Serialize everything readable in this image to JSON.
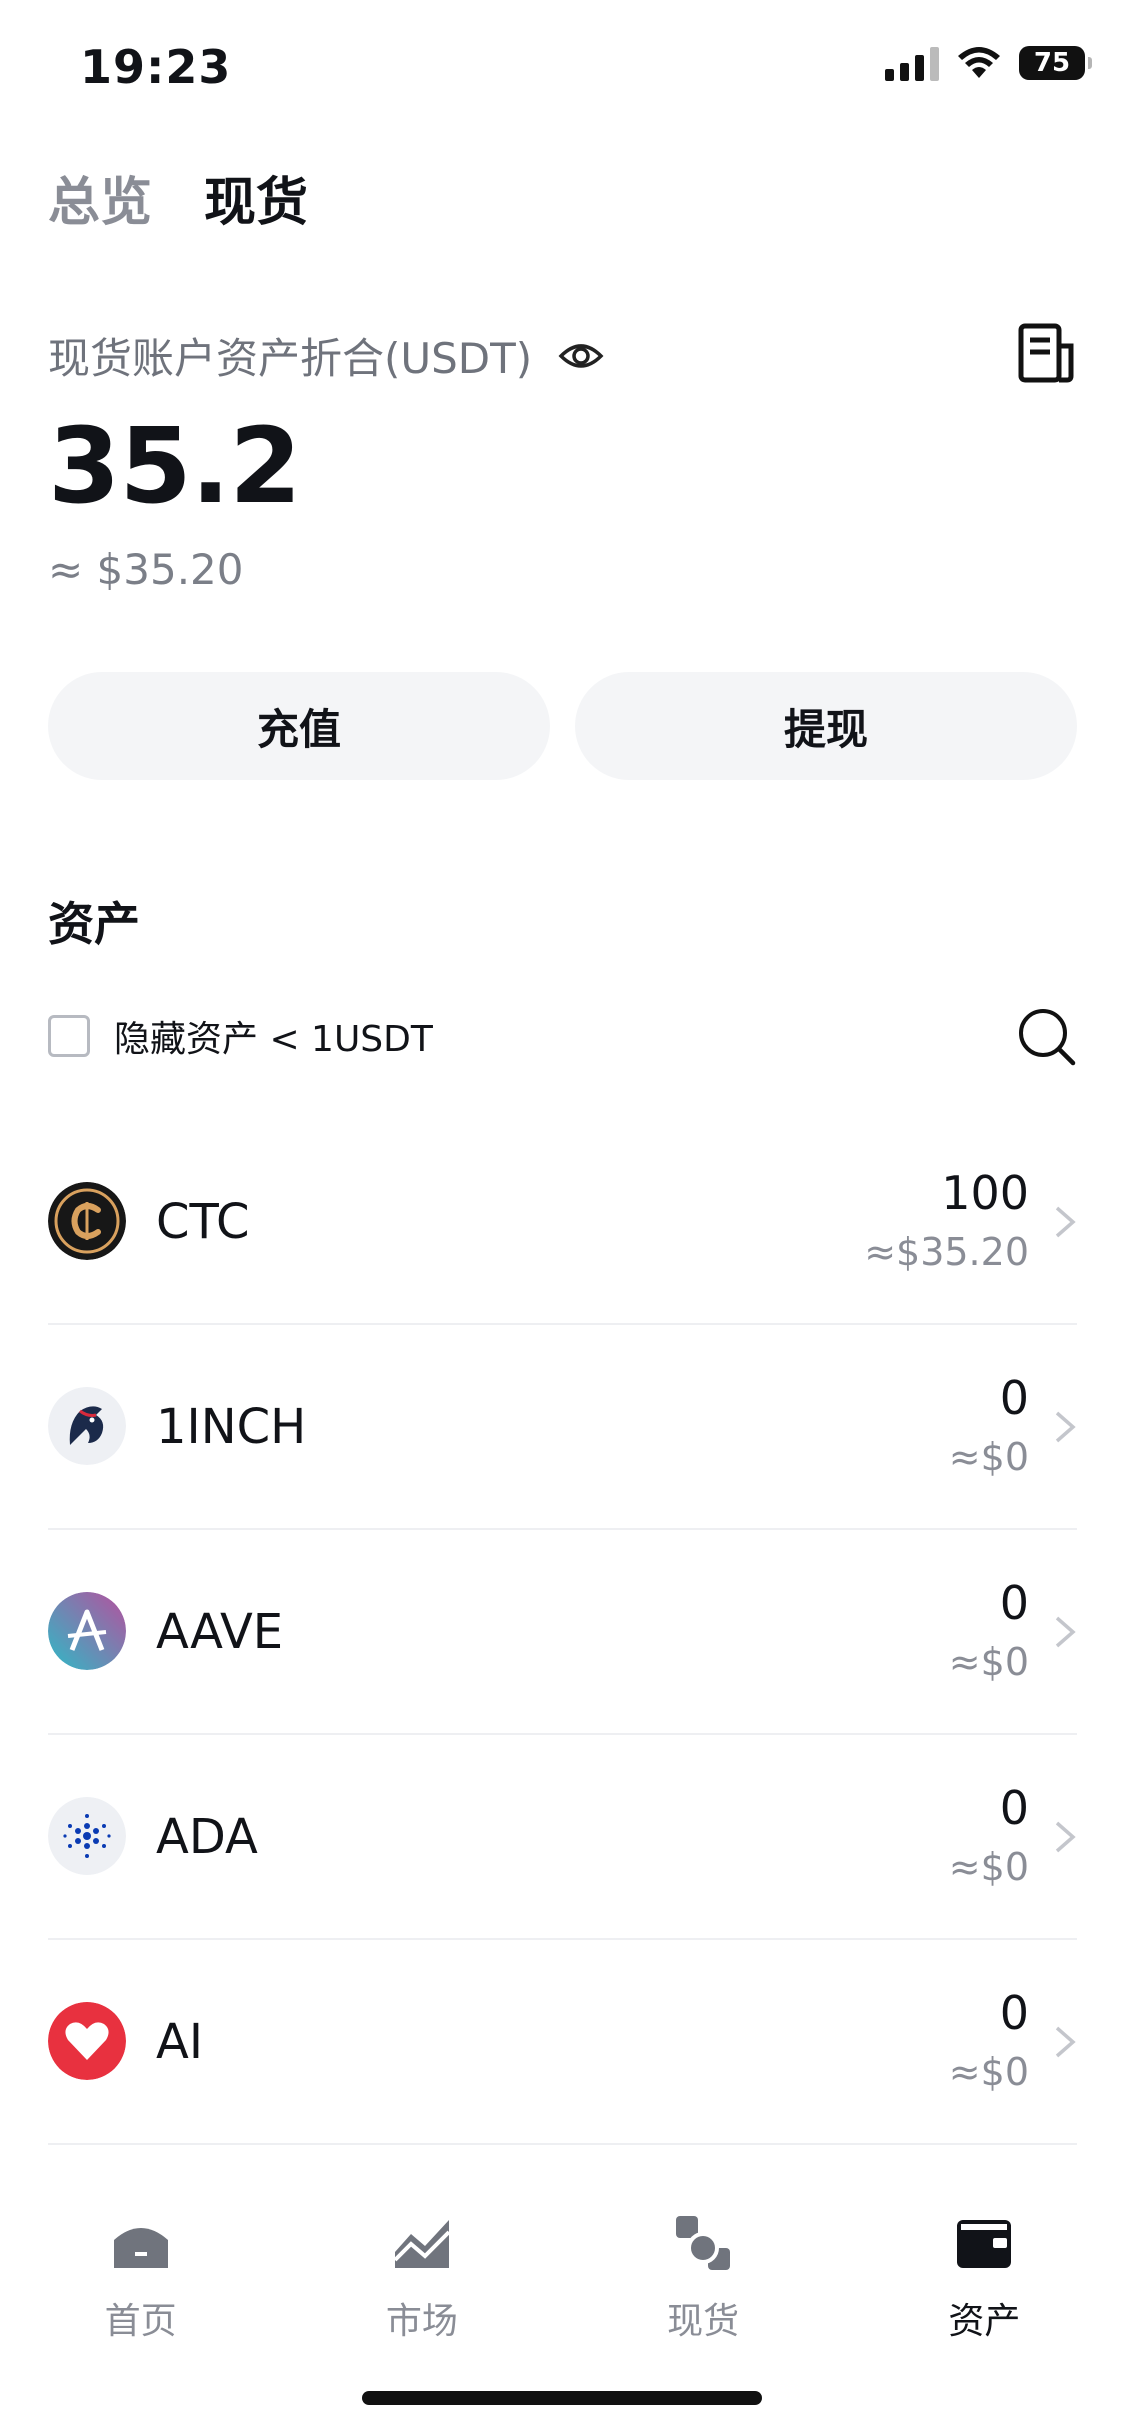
{
  "status_bar": {
    "time": "19:23",
    "battery": "75"
  },
  "top_tabs": [
    {
      "label": "总览",
      "active": false
    },
    {
      "label": "现货",
      "active": true
    }
  ],
  "account": {
    "label": "现货账户资产折合(USDT)",
    "balance": "35.2",
    "balance_usd": "≈ $35.20"
  },
  "actions": {
    "deposit_label": "充值",
    "withdraw_label": "提现"
  },
  "assets_section": {
    "title": "资产",
    "hide_small_label": "隐藏资产 < 1USDT",
    "hide_small_checked": false
  },
  "assets": [
    {
      "name": "CTC",
      "amount": "100",
      "value": "≈$35.20",
      "icon": "ctc-coin"
    },
    {
      "name": "1INCH",
      "amount": "0",
      "value": "≈$0",
      "icon": "1inch-coin"
    },
    {
      "name": "AAVE",
      "amount": "0",
      "value": "≈$0",
      "icon": "aave-coin"
    },
    {
      "name": "ADA",
      "amount": "0",
      "value": "≈$0",
      "icon": "ada-coin"
    },
    {
      "name": "AI",
      "amount": "0",
      "value": "≈$0",
      "icon": "ai-coin"
    }
  ],
  "bottom_nav": [
    {
      "label": "首页",
      "icon": "home-icon",
      "active": false
    },
    {
      "label": "市场",
      "icon": "market-icon",
      "active": false
    },
    {
      "label": "现货",
      "icon": "spot-icon",
      "active": false
    },
    {
      "label": "资产",
      "icon": "wallet-icon",
      "active": true
    }
  ],
  "colors": {
    "text_primary": "#111318",
    "text_secondary": "#8a8d96",
    "button_bg": "#f4f5f7",
    "divider": "#eeeff2"
  }
}
